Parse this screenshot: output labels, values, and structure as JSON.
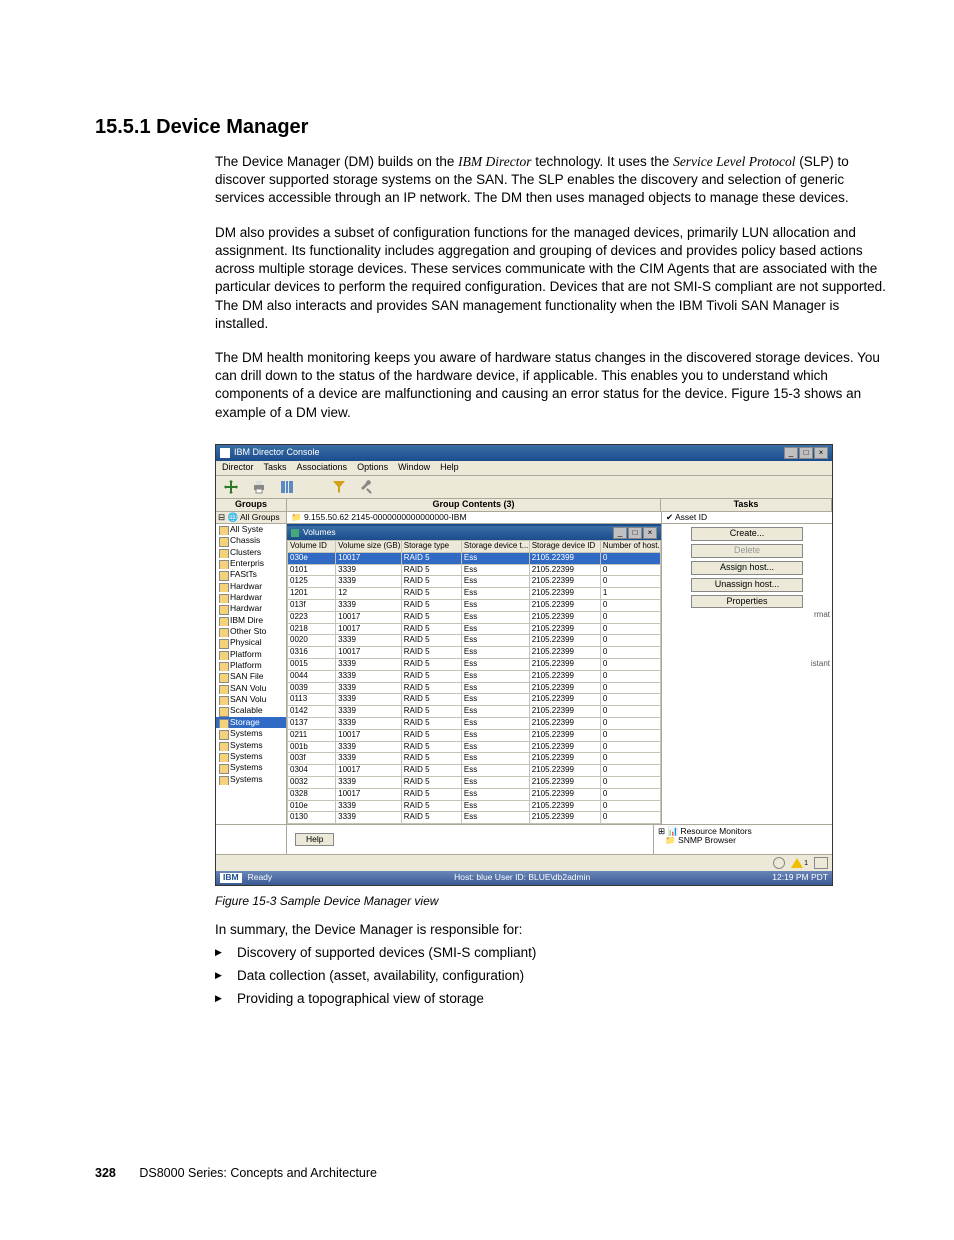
{
  "heading": "15.5.1  Device Manager",
  "para1a": "The Device Manager (DM) builds on the ",
  "para1b": "IBM Director",
  "para1c": " technology. It uses the ",
  "para1d": "Service Level Protocol",
  "para1e": " (SLP) to discover supported storage systems on the SAN. The SLP enables the discovery and selection of generic services accessible through an IP network. The DM then uses managed objects to manage these devices.",
  "para2": "DM also provides a subset of configuration functions for the managed devices, primarily LUN allocation and assignment. Its functionality includes aggregation and grouping of devices and provides policy based actions across multiple storage devices. These services communicate with the CIM Agents that are associated with the particular devices to perform the required configuration. Devices that are not SMI-S compliant are not supported. The DM also interacts and provides SAN management functionality when the IBM Tivoli SAN Manager is installed.",
  "para3": "The DM health monitoring keeps you aware of hardware status changes in the discovered storage devices. You can drill down to the status of the hardware device, if applicable. This enables you to understand which components of a device are malfunctioning and causing an error status for the device. Figure 15-3 shows an example of a DM view.",
  "figcaption": "Figure 15-3   Sample Device Manager view",
  "summary_intro": "In summary, the Device Manager is responsible for:",
  "bullets": [
    "Discovery of supported devices (SMI-S compliant)",
    "Data collection (asset, availability, configuration)",
    "Providing a topographical view of storage"
  ],
  "footer_page": "328",
  "footer_title": "DS8000 Series: Concepts and Architecture",
  "shot": {
    "title": "IBM Director Console",
    "menus": [
      "Director",
      "Tasks",
      "Associations",
      "Options",
      "Window",
      "Help"
    ],
    "hdr_groups": "Groups",
    "hdr_content": "Group Contents (3)",
    "hdr_tasks": "Tasks",
    "groups_top": "⊟ 🌐 All Groups",
    "tree": [
      "All Syste",
      "Chassis",
      "Clusters",
      "Enterpris",
      "FAStTs",
      "Hardwar",
      "Hardwar",
      "Hardwar",
      "IBM Dire",
      "Other Sto",
      "Physical",
      "Platform",
      "Platform",
      "SAN File",
      "SAN Volu",
      "SAN Volu",
      "Scalable",
      "Storage",
      "Systems",
      "Systems",
      "Systems",
      "Systems",
      "Systems"
    ],
    "tree_sel_index": 17,
    "content_top": "📁 9.155.50.62 2145-0000000000000000-IBM",
    "inner_title": "Volumes",
    "table_headers": [
      "Volume ID",
      "Volume size (GB)",
      "Storage type",
      "Storage device t...",
      "Storage device ID",
      "Number of host..."
    ],
    "rows": [
      [
        "030e",
        "10017",
        "RAID 5",
        "Ess",
        "2105.22399",
        "0"
      ],
      [
        "0101",
        "3339",
        "RAID 5",
        "Ess",
        "2105.22399",
        "0"
      ],
      [
        "0125",
        "3339",
        "RAID 5",
        "Ess",
        "2105.22399",
        "0"
      ],
      [
        "1201",
        "12",
        "RAID 5",
        "Ess",
        "2105.22399",
        "1"
      ],
      [
        "013f",
        "3339",
        "RAID 5",
        "Ess",
        "2105.22399",
        "0"
      ],
      [
        "0223",
        "10017",
        "RAID 5",
        "Ess",
        "2105.22399",
        "0"
      ],
      [
        "0218",
        "10017",
        "RAID 5",
        "Ess",
        "2105.22399",
        "0"
      ],
      [
        "0020",
        "3339",
        "RAID 5",
        "Ess",
        "2105.22399",
        "0"
      ],
      [
        "0316",
        "10017",
        "RAID 5",
        "Ess",
        "2105.22399",
        "0"
      ],
      [
        "0015",
        "3339",
        "RAID 5",
        "Ess",
        "2105.22399",
        "0"
      ],
      [
        "0044",
        "3339",
        "RAID 5",
        "Ess",
        "2105.22399",
        "0"
      ],
      [
        "0039",
        "3339",
        "RAID 5",
        "Ess",
        "2105.22399",
        "0"
      ],
      [
        "0113",
        "3339",
        "RAID 5",
        "Ess",
        "2105.22399",
        "0"
      ],
      [
        "0142",
        "3339",
        "RAID 5",
        "Ess",
        "2105.22399",
        "0"
      ],
      [
        "0137",
        "3339",
        "RAID 5",
        "Ess",
        "2105.22399",
        "0"
      ],
      [
        "0211",
        "10017",
        "RAID 5",
        "Ess",
        "2105.22399",
        "0"
      ],
      [
        "001b",
        "3339",
        "RAID 5",
        "Ess",
        "2105.22399",
        "0"
      ],
      [
        "003f",
        "3339",
        "RAID 5",
        "Ess",
        "2105.22399",
        "0"
      ],
      [
        "0304",
        "10017",
        "RAID 5",
        "Ess",
        "2105.22399",
        "0"
      ],
      [
        "0032",
        "3339",
        "RAID 5",
        "Ess",
        "2105.22399",
        "0"
      ],
      [
        "0328",
        "10017",
        "RAID 5",
        "Ess",
        "2105.22399",
        "0"
      ],
      [
        "010e",
        "3339",
        "RAID 5",
        "Ess",
        "2105.22399",
        "0"
      ],
      [
        "0130",
        "3339",
        "RAID 5",
        "Ess",
        "2105.22399",
        "0"
      ]
    ],
    "tasks_top": "✔ Asset ID",
    "actions": [
      "Create...",
      "Delete",
      "Assign host...",
      "Unassign host...",
      "Properties"
    ],
    "action_disabled_index": 1,
    "side_word": "istant",
    "side_word2": "rmat",
    "help_btn": "Help",
    "res_monitors": "Resource Monitors",
    "snmp_browser": "SNMP Browser",
    "status_ready": "Ready",
    "status_host": "Host: blue  User ID: BLUE\\db2admin",
    "status_time": "12:19 PM PDT",
    "warn_badge": "1"
  }
}
